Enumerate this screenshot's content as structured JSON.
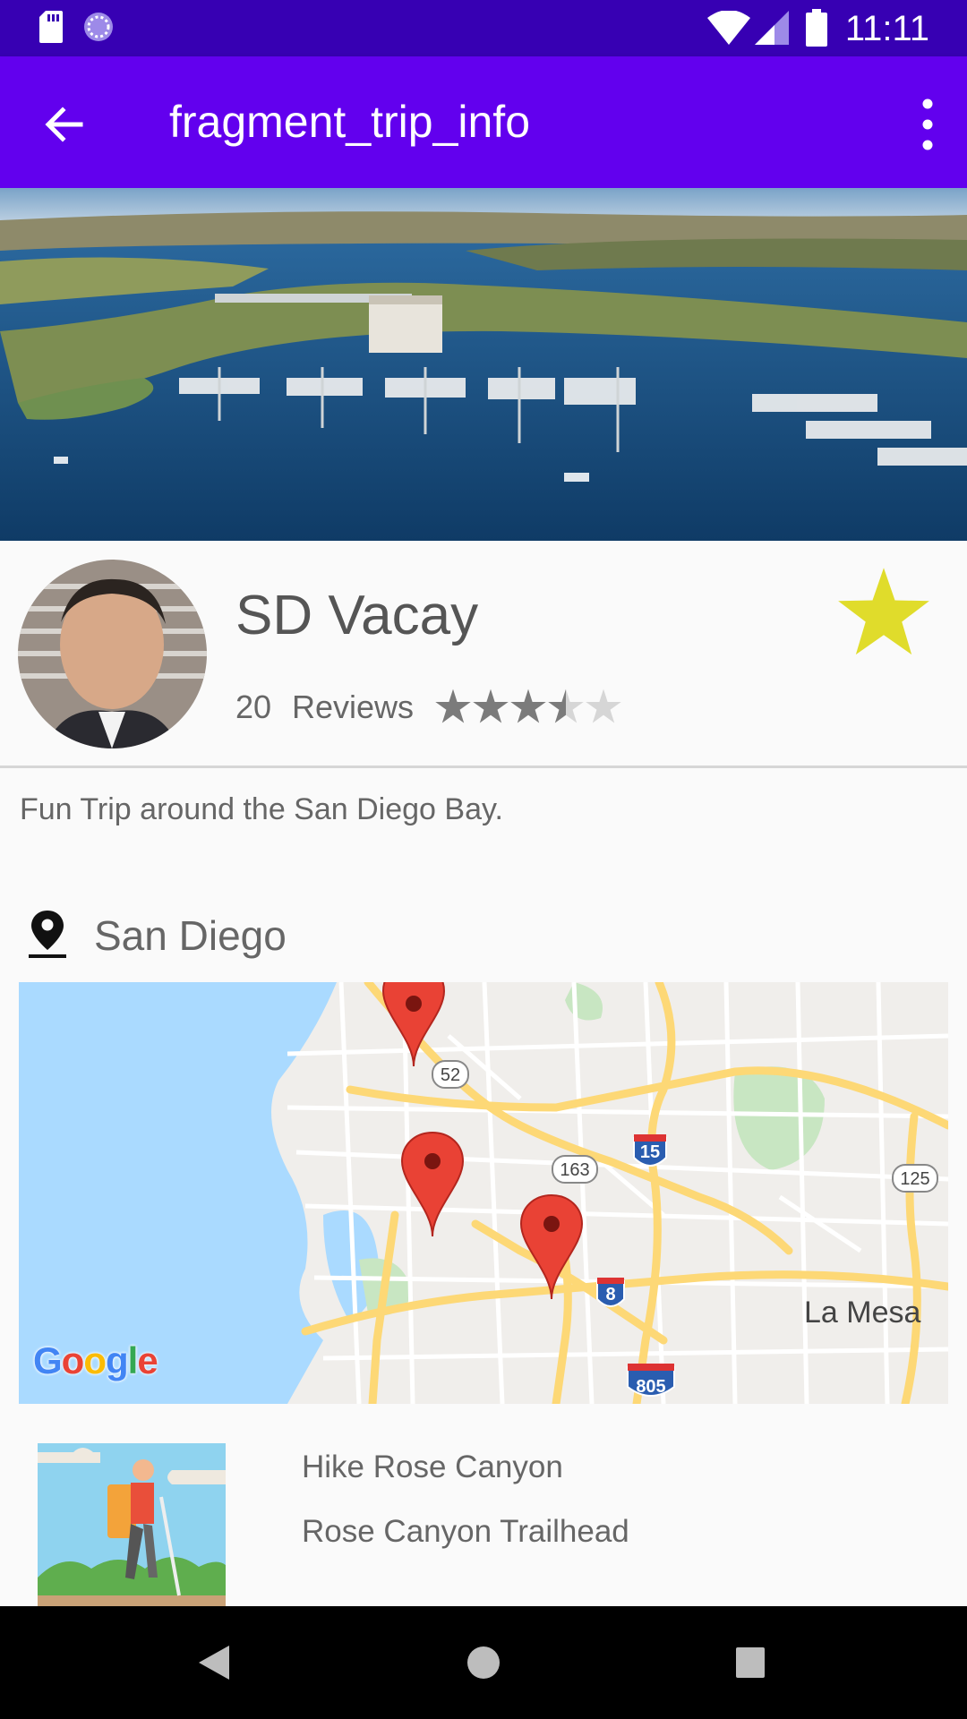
{
  "status_bar": {
    "time": "11:11",
    "icons": [
      "sd-card-icon",
      "sync-icon",
      "wifi-icon",
      "signal-icon",
      "battery-icon"
    ]
  },
  "app_bar": {
    "title": "fragment_trip_info",
    "icons": [
      "back-arrow-icon",
      "overflow-menu-icon"
    ]
  },
  "trip": {
    "title": "SD Vacay",
    "review_count": "20",
    "reviews_label": "Reviews",
    "rating": 3.5,
    "rating_max": 5,
    "description": "Fun Trip around the San Diego Bay.",
    "favorite": true
  },
  "location": {
    "label": "San Diego"
  },
  "map": {
    "city_label": "La Mesa",
    "logo_text": "Google",
    "route_shields": [
      "52",
      "163",
      "15",
      "125",
      "8",
      "805"
    ],
    "marker_count": 3
  },
  "activity": {
    "name": "Hike Rose Canyon",
    "location": "Rose Canyon Trailhead"
  },
  "colors": {
    "status_bar": "#3700b3",
    "app_bar": "#6200ee",
    "favorite_star": "#e0dc2b",
    "marker": "#e94235",
    "water": "#aadaff",
    "highway": "#fdd876"
  }
}
